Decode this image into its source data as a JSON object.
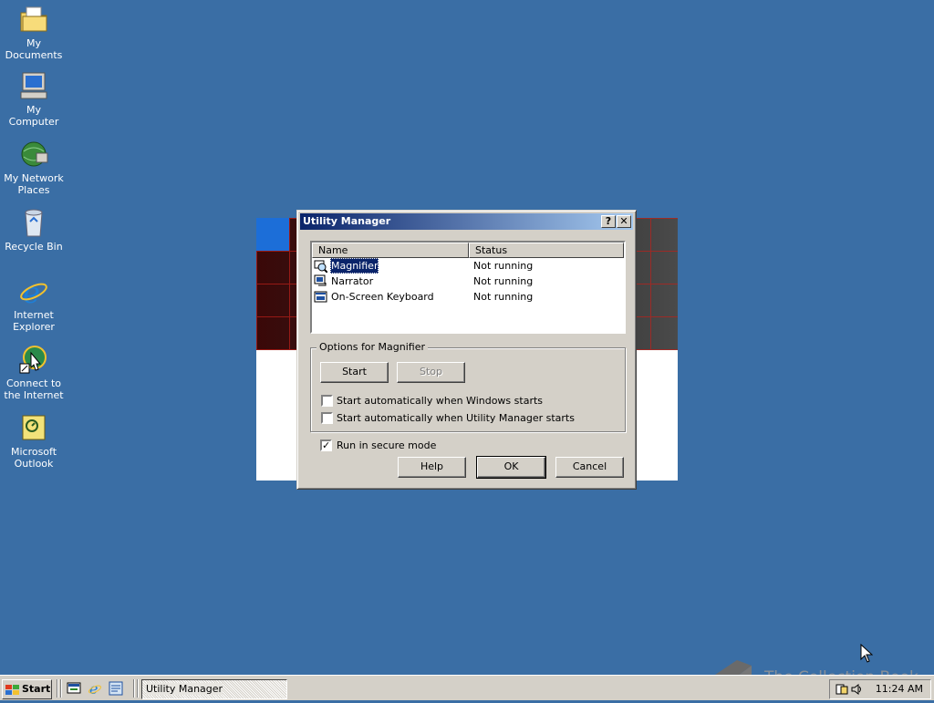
{
  "desktop": {
    "icons": [
      {
        "label": "My Documents",
        "icon": "folder-documents-icon"
      },
      {
        "label": "My Computer",
        "icon": "computer-icon"
      },
      {
        "label": "My Network Places",
        "icon": "network-places-icon"
      },
      {
        "label": "Recycle Bin",
        "icon": "recycle-bin-icon"
      },
      {
        "label": "Internet Explorer",
        "icon": "internet-explorer-icon"
      },
      {
        "label": "Connect to the Internet",
        "icon": "connect-internet-icon"
      },
      {
        "label": "Microsoft Outlook",
        "icon": "outlook-icon"
      }
    ]
  },
  "dialog": {
    "title": "Utility Manager",
    "help_btn": "?",
    "close_btn": "✕",
    "columns": {
      "name": "Name",
      "status": "Status"
    },
    "utilities": [
      {
        "name": "Magnifier",
        "status": "Not running",
        "selected": true
      },
      {
        "name": "Narrator",
        "status": "Not running",
        "selected": false
      },
      {
        "name": "On-Screen Keyboard",
        "status": "Not running",
        "selected": false
      }
    ],
    "options": {
      "title": "Options for Magnifier",
      "start_label": "Start",
      "stop_label": "Stop",
      "auto_windows_label": "Start automatically when Windows starts",
      "auto_windows_checked": false,
      "auto_um_label": "Start automatically when Utility Manager starts",
      "auto_um_checked": false
    },
    "secure_mode_label": "Run in secure mode",
    "secure_mode_checked": true,
    "help_label": "Help",
    "ok_label": "OK",
    "cancel_label": "Cancel"
  },
  "taskbar": {
    "start_label": "Start",
    "task_label": "Utility Manager",
    "clock": "11:24 AM"
  },
  "watermark": "The Collection Book",
  "colors": {
    "desktop": "#3a6ea5",
    "title_active_start": "#0a246a",
    "title_active_end": "#a6caf0",
    "face": "#d4d0c8"
  }
}
